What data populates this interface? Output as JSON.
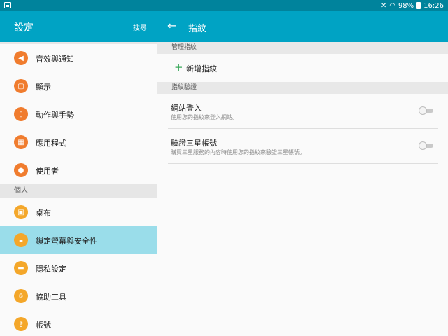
{
  "status_bar": {
    "battery": "98%",
    "time": "16:26",
    "icons": [
      "screenshot-icon",
      "mute-icon",
      "wifi-icon",
      "battery-icon"
    ]
  },
  "left_header": {
    "title": "設定",
    "search": "搜尋"
  },
  "right_header": {
    "title": "指紋",
    "back_icon": "back-arrow-icon"
  },
  "sidebar": {
    "items": [
      {
        "label": "音效與通知",
        "icon": "volume-icon"
      },
      {
        "label": "顯示",
        "icon": "display-icon"
      },
      {
        "label": "動作與手勢",
        "icon": "motion-icon"
      },
      {
        "label": "應用程式",
        "icon": "apps-icon"
      },
      {
        "label": "使用者",
        "icon": "users-icon"
      }
    ],
    "section_personal": "個人",
    "personal_items": [
      {
        "label": "桌布",
        "icon": "wallpaper-icon"
      },
      {
        "label": "鎖定螢幕與安全性",
        "icon": "lock-icon",
        "selected": true
      },
      {
        "label": "隱私設定",
        "icon": "privacy-icon"
      },
      {
        "label": "協助工具",
        "icon": "accessibility-icon"
      },
      {
        "label": "帳號",
        "icon": "key-icon"
      }
    ]
  },
  "fingerprint": {
    "manage_section": "管理指紋",
    "add_label": "新增指紋",
    "verify_section": "指紋驗證",
    "web_signin": {
      "title": "網站登入",
      "desc": "使用您的指紋來登入網站。",
      "enabled": false
    },
    "samsung_account": {
      "title": "驗證三星帳號",
      "desc": "購買三星服務的內容時使用您的指紋來驗證三星帳號。",
      "enabled": false
    }
  },
  "colors": {
    "header": "#00a3c4",
    "status_bar": "#00839c",
    "selected_row": "#9addea",
    "icon_orange": "#f07c2e",
    "icon_amber": "#f4a72a",
    "add_green": "#3aa85b"
  }
}
